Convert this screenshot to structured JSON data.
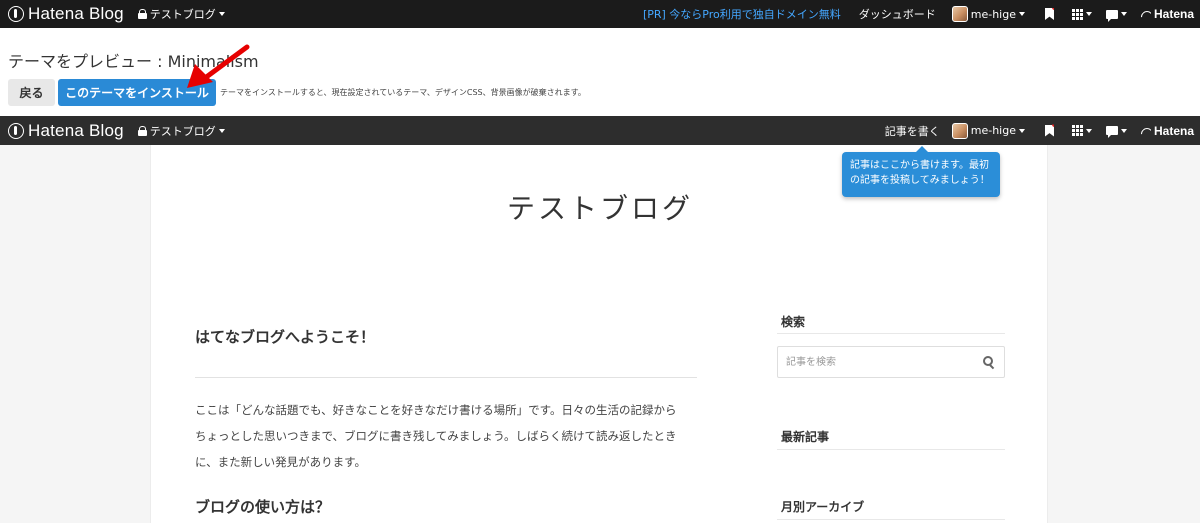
{
  "topbar": {
    "logo_text": "Hatena Blog",
    "blog_name": "テストブログ",
    "promo": "[PR] 今ならPro利用で独自ドメイン無料",
    "dashboard": "ダッシュボード",
    "user": "me-hige"
  },
  "preview": {
    "title": "テーマをプレビュー : Minimalism",
    "back_label": "戻る",
    "install_label": "このテーマをインストール",
    "note": "テーマをインストールすると、現在設定されているテーマ、デザインCSS、背景画像が破棄されます。"
  },
  "inner_bar": {
    "logo_text": "Hatena Blog",
    "blog_name": "テストブログ",
    "write": "記事を書く",
    "user": "me-hige",
    "hatena": "Hatena"
  },
  "tooltip": {
    "line1": "記事はここから書けます。最初",
    "line2": "の記事を投稿してみましょう！"
  },
  "blog": {
    "title": "テストブログ",
    "entry_title": "はてなブログへようこそ！",
    "entry_lines": [
      "ここは「どんな話題でも、好きなことを好きなだけ書ける場所」です。日々の生活の記録から",
      "ちょっとした思いつきまで、ブログに書き残してみましょう。しばらく続けて読み返したとき",
      "に、また新しい発見があります。"
    ],
    "entry_h2": "ブログの使い方は？"
  },
  "sidebar": {
    "search_head": "検索",
    "search_placeholder": "記事を検索",
    "recent_head": "最新記事",
    "archive_head": "月別アーカイブ"
  },
  "colors": {
    "topbar_bg": "#1b1b1b",
    "inner_bar_bg": "#2d2d2d",
    "accent_blue": "#2a8ad6",
    "promo_link": "#44a7ff",
    "arrow_red": "#e60000"
  }
}
